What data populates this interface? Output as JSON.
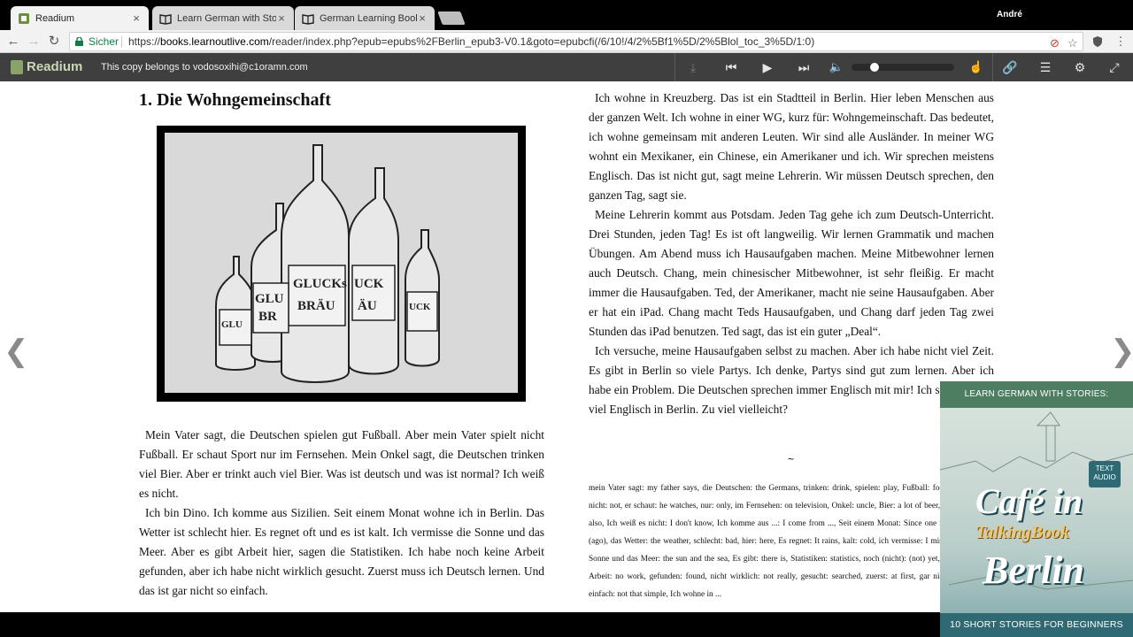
{
  "tabs": [
    {
      "label": "Readium",
      "active": true
    },
    {
      "label": "Learn German with Storie",
      "active": false
    },
    {
      "label": "German Learning Books",
      "active": false
    }
  ],
  "user_name": "André",
  "address": {
    "secure_label": "Sicher",
    "url_scheme": "https://",
    "url_host": "books.learnoutlive.com",
    "url_path": "/reader/index.php?epub=epubs%2FBerlin_epub3-V0.1&goto=epubcfi(/6/10!/4/2%5Bf1%5D/2%5Blol_toc_3%5D/1:0)"
  },
  "readium": {
    "logo": "Readium",
    "copy_note": "This copy belongs to vodosoxihi@c1oramn.com"
  },
  "chapter_title": "1. Die Wohngemeinschaft",
  "left_paragraphs": [
    "Mein Vater sagt, die Deutschen spielen gut Fußball. Aber mein Vater spielt nicht Fußball. Er schaut Sport nur im Fernsehen. Mein Onkel sagt, die Deutschen trinken viel Bier. Aber er trinkt auch viel Bier. Was ist deutsch und was ist normal? Ich weiß es nicht.",
    "Ich bin Dino. Ich komme aus Sizilien. Seit einem Monat wohne ich in Berlin. Das Wetter ist schlecht hier. Es regnet oft und es ist kalt. Ich vermisse die Sonne und das Meer. Aber es gibt Arbeit hier, sagen die Statistiken. Ich habe noch keine Arbeit gefunden, aber ich habe nicht wirklich gesucht. Zuerst muss ich Deutsch lernen. Und das ist gar nicht so einfach."
  ],
  "right_paragraphs": [
    "Ich wohne in Kreuzberg. Das ist ein Stadtteil in Berlin. Hier leben Menschen aus der ganzen Welt. Ich wohne in einer WG, kurz für: Wohngemeinschaft. Das bedeutet, ich wohne gemeinsam mit anderen Leuten. Wir sind alle Ausländer. In meiner WG wohnt ein Mexikaner, ein Chinese, ein Amerikaner und ich. Wir sprechen meistens Englisch. Das ist nicht gut, sagt meine Lehrerin. Wir müssen Deutsch sprechen, den ganzen Tag, sagt sie.",
    "Meine Lehrerin kommt aus Potsdam. Jeden Tag gehe ich zum Deutsch-Unterricht. Drei Stunden, jeden Tag! Es ist oft langweilig. Wir lernen Grammatik und machen Übungen. Am Abend muss ich Hausaufgaben machen. Meine Mitbewohner lernen auch Deutsch. Chang, mein chinesischer Mitbewohner, ist sehr fleißig. Er macht immer die Hausaufgaben. Ted, der Amerikaner, macht nie seine Hausaufgaben. Aber er hat ein iPad. Chang macht Teds Hausaufgaben, und Chang darf jeden Tag zwei Stunden das iPad benutzen. Ted sagt, das ist ein guter „Deal“.",
    "Ich versuche, meine Hausaufgaben selbst zu machen. Aber ich habe nicht viel Zeit. Es gibt in Berlin so viele Partys. Ich denke, Partys sind gut zum lernen. Aber ich habe ein Problem. Die Deutschen sprechen immer Englisch mit mir! Ich spreche sehr viel Englisch in Berlin. Zu viel vielleicht?"
  ],
  "separator": "~",
  "glossary": "mein Vater sagt: my father says, die Deutschen: the Germans, trinken: drink, spielen: play, Fußball: football, nicht: not, er schaut: he watches, nur: only, im Fernsehen: on television, Onkel: uncle, Bier: a lot of beer, auch: also, Ich weiß es nicht: I don't know, Ich komme aus ...: I come from ..., Seit einem Monat: Since one month (ago), das Wetter: the weather, schlecht: bad, hier: here, Es regnet: It rains, kalt: cold, ich vermisse: I miss, die Sonne und das Meer: the sun and the sea, Es gibt: there is, Statistiken: statistics, noch (nicht): (not) yet, keine Arbeit: no work, gefunden: found, nicht wirklich: not really, gesucht: searched, zuerst: at first, gar nicht so einfach: not that simple, Ich wohne in ...",
  "cover": {
    "top_text": "LEARN GERMAN WITH STORIES:",
    "badge": "TEXT AUDIO",
    "title_1": "Café in",
    "title_2": "TalkingBook",
    "title_3": "Berlin",
    "bottom_text": "10 SHORT STORIES FOR BEGINNERS"
  },
  "colors": {
    "readium_bar": "#3f3f3f",
    "secure_green": "#0b8043",
    "cover_teal": "#2f6a74",
    "cover_green": "#4e7e61"
  }
}
